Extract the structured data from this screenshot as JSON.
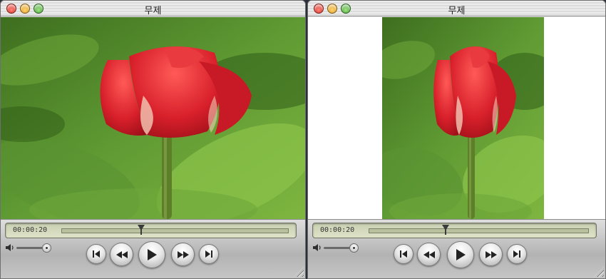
{
  "windows": [
    {
      "id": "left",
      "title": "무제",
      "timecode": "00:00:20",
      "playhead_fraction": 0.35,
      "volume_fraction": 0.92,
      "letterboxed": false
    },
    {
      "id": "right",
      "title": "무제",
      "timecode": "00:00:20",
      "playhead_fraction": 0.35,
      "volume_fraction": 0.92,
      "letterboxed": true
    }
  ],
  "controls": {
    "buttons": [
      "go-to-start",
      "rewind",
      "play",
      "fast-forward",
      "go-to-end"
    ]
  },
  "icons": {
    "close": "close-icon",
    "minimize": "minimize-icon",
    "zoom": "zoom-icon",
    "volume": "speaker-icon",
    "resize": "resize-grip-icon"
  },
  "colors": {
    "close": "#d8261d",
    "minimize": "#e19a14",
    "zoom": "#3fa12a",
    "lcd": "#d4dabd",
    "tulip": "#d8202b",
    "foliage": "#4c8a28"
  }
}
